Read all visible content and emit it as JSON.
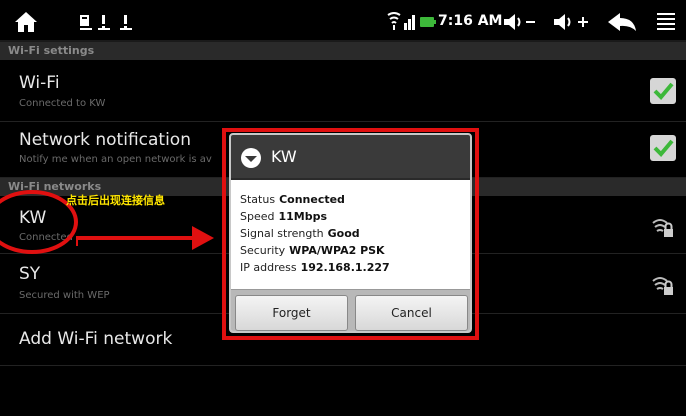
{
  "status_bar": {
    "time": "7:16 AM",
    "icons": [
      "home-icon",
      "notification-icons",
      "signal-icons",
      "volume-down-icon",
      "volume-up-icon",
      "back-icon",
      "menu-icon"
    ]
  },
  "sections": {
    "wifi_settings": "Wi-Fi settings",
    "wifi_networks": "Wi-Fi networks"
  },
  "settings": {
    "wifi": {
      "title": "Wi-Fi",
      "subtitle": "Connected to KW",
      "checked": true
    },
    "network_notification": {
      "title": "Network notification",
      "subtitle": "Notify me when an open network is av",
      "checked": true
    }
  },
  "networks": [
    {
      "name": "KW",
      "subtitle": "Connected"
    },
    {
      "name": "SY",
      "subtitle": "Secured with WEP"
    }
  ],
  "add_network": "Add Wi-Fi network",
  "annotation": {
    "text": "点击后出现连接信息",
    "color": "#e01010",
    "text_color": "#ffe600"
  },
  "dialog": {
    "title": "KW",
    "rows": [
      {
        "label": "Status",
        "value": "Connected"
      },
      {
        "label": "Speed",
        "value": "11Mbps"
      },
      {
        "label": "Signal strength",
        "value": "Good"
      },
      {
        "label": "Security",
        "value": "WPA/WPA2 PSK"
      },
      {
        "label": "IP address",
        "value": "192.168.1.227"
      }
    ],
    "buttons": {
      "forget": "Forget",
      "cancel": "Cancel"
    }
  },
  "colors": {
    "checkbox_check": "#3db83a",
    "section_bg": "#2a2a2a"
  }
}
